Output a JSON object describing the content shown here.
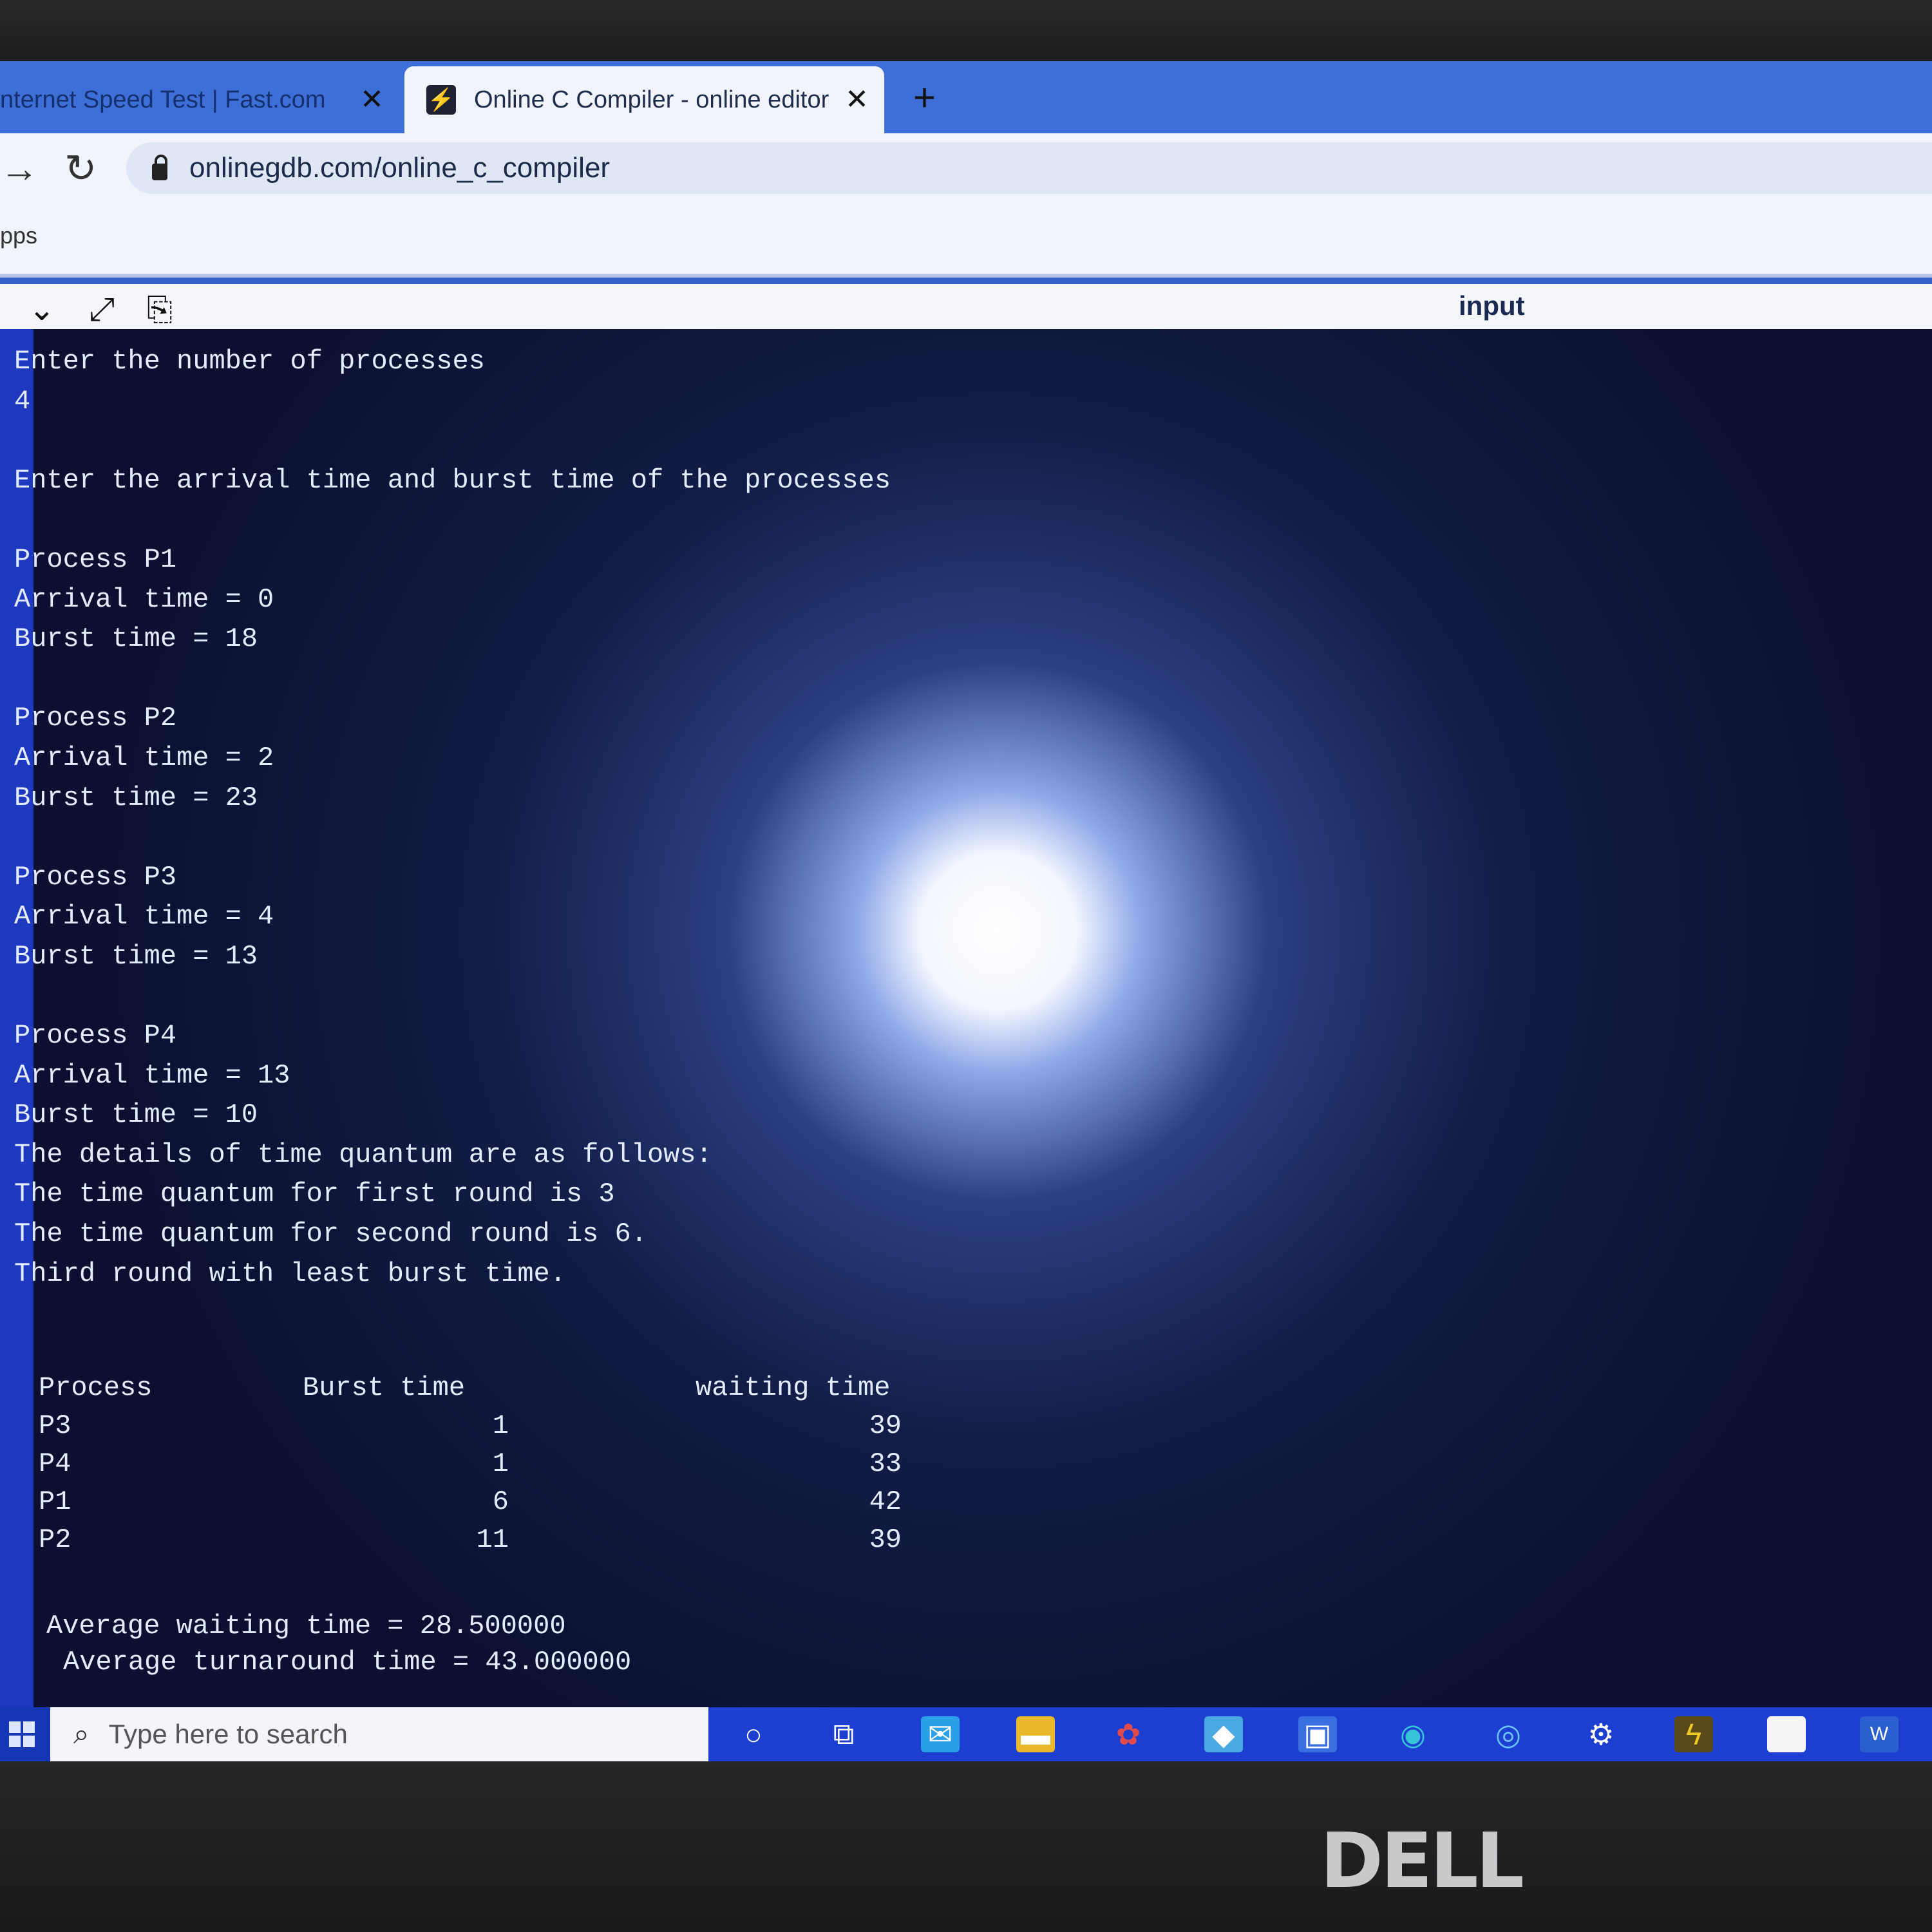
{
  "browser": {
    "tabs": [
      {
        "label": "nternet Speed Test | Fast.com",
        "active": false
      },
      {
        "label": "Online C Compiler - online editor",
        "active": true
      }
    ],
    "url": "onlinegdb.com/online_c_compiler",
    "bookmarks_label": "pps"
  },
  "gdb": {
    "panel_label": "input"
  },
  "terminal": {
    "lines": [
      "Enter the number of processes",
      "4",
      "",
      "Enter the arrival time and burst time of the processes",
      "",
      "Process P1",
      "Arrival time = 0",
      "Burst time = 18",
      "",
      "Process P2",
      "Arrival time = 2",
      "Burst time = 23",
      "",
      "Process P3",
      "Arrival time = 4",
      "Burst time = 13",
      "",
      "Process P4",
      "Arrival time = 13",
      "Burst time = 10",
      "The details of time quantum are as follows:",
      "The time quantum for first round is 3",
      "The time quantum for second round is 6.",
      "Third round with least burst time."
    ],
    "table": {
      "headers": [
        "Process",
        "Burst time",
        "waiting time"
      ],
      "rows": [
        [
          "P3",
          "1",
          "39"
        ],
        [
          "P4",
          "1",
          "33"
        ],
        [
          "P1",
          "6",
          "42"
        ],
        [
          "P2",
          "11",
          "39"
        ]
      ]
    },
    "avg_waiting": "Average waiting time = 28.500000",
    "avg_turnaround": "Average turnaround time = 43.000000"
  },
  "taskbar": {
    "search_placeholder": "Type here to search"
  },
  "brand": "DELL"
}
